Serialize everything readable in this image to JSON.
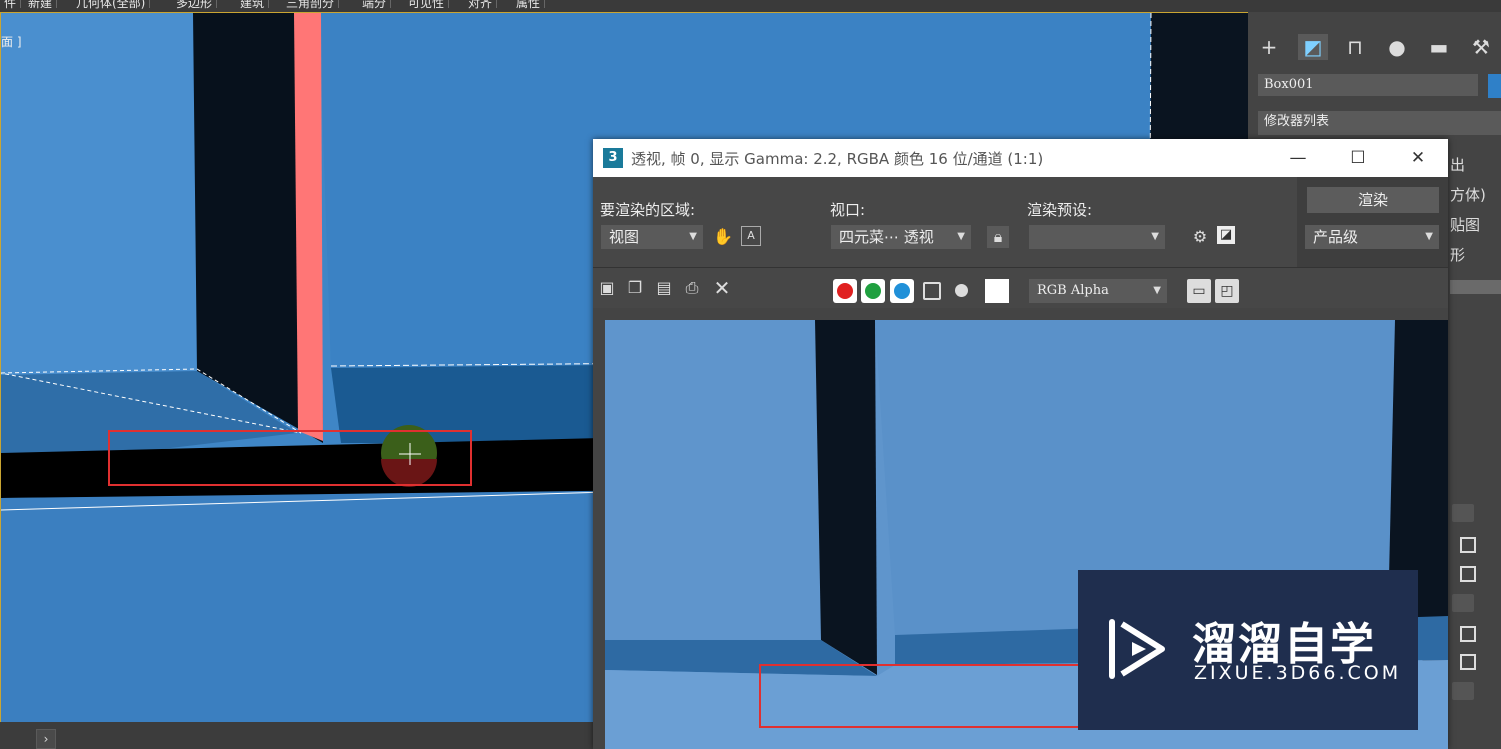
{
  "topbar": {
    "items": [
      "件",
      "新建",
      "几何体(全部)",
      "多边形",
      "建筑",
      "三角剖分",
      "端分",
      "可见性",
      "对齐",
      "属性"
    ]
  },
  "viewport": {
    "label": "面 ]"
  },
  "command_panel": {
    "object_name": "Box001",
    "modifier_list": "修改器列表",
    "fragments": [
      "出",
      "方体)",
      "贴图",
      "形"
    ]
  },
  "render_window": {
    "title": "透视, 帧 0, 显示 Gamma: 2.2, RGBA 颜色 16 位/通道 (1:1)",
    "logo": "3",
    "area_label": "要渲染的区域:",
    "area_value": "视图",
    "viewport_label": "视口:",
    "viewport_value": "四元菜⋯ 透视",
    "preset_label": "渲染预设:",
    "preset_value": "",
    "render_button": "渲染",
    "quality_value": "产品级",
    "channel_value": "RGB Alpha",
    "minimize": "—",
    "maximize": "☐",
    "close": "✕"
  },
  "watermark": {
    "brand": "溜溜自学",
    "url": "ZIXUE.3D66.COM"
  },
  "colors": {
    "viewport_bg": "#3d82c0",
    "red_column": "#ff7676",
    "highlight": "#e03030",
    "accent": "#c9a532"
  }
}
